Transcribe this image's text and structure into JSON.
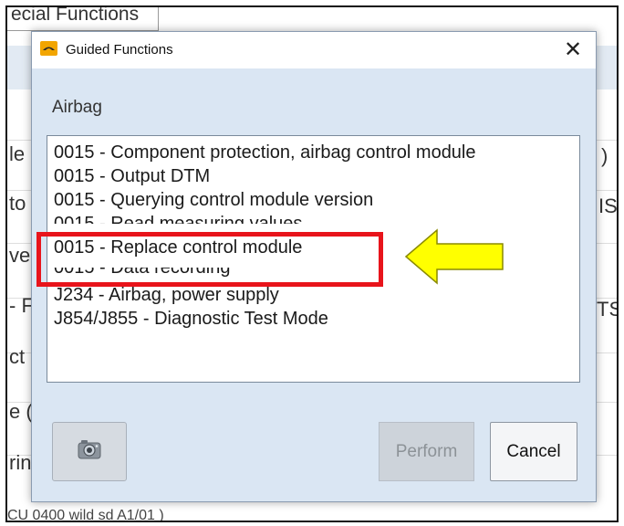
{
  "background": {
    "tab_label": "ecial Functions",
    "row_fragments": [
      "le",
      "to",
      "ve",
      "- F",
      "ct",
      "e (",
      "rin"
    ],
    "right_fragments": [
      ")",
      "IS",
      "TSC"
    ],
    "footer_text": "CU  0400  wild sd  A1/01  )"
  },
  "dialog": {
    "title": "Guided Functions",
    "close_symbol": "✕",
    "section_label": "Airbag",
    "items": [
      "0015 - Component protection, airbag control module",
      "0015 - Output DTM",
      "0015 - Querying control module version",
      "0015 - Read measuring values",
      "0015 - Replace control module",
      "0015 - Data recording",
      "J234 - Airbag, power supply",
      "J854/J855 - Diagnostic Test Mode"
    ],
    "buttons": {
      "camera_icon": "camera-icon",
      "perform": "Perform",
      "cancel": "Cancel"
    }
  },
  "annotations": {
    "highlight_color": "#e8141b",
    "arrow_color": "#ffff00",
    "highlighted_item": "0015 - Replace control module"
  }
}
